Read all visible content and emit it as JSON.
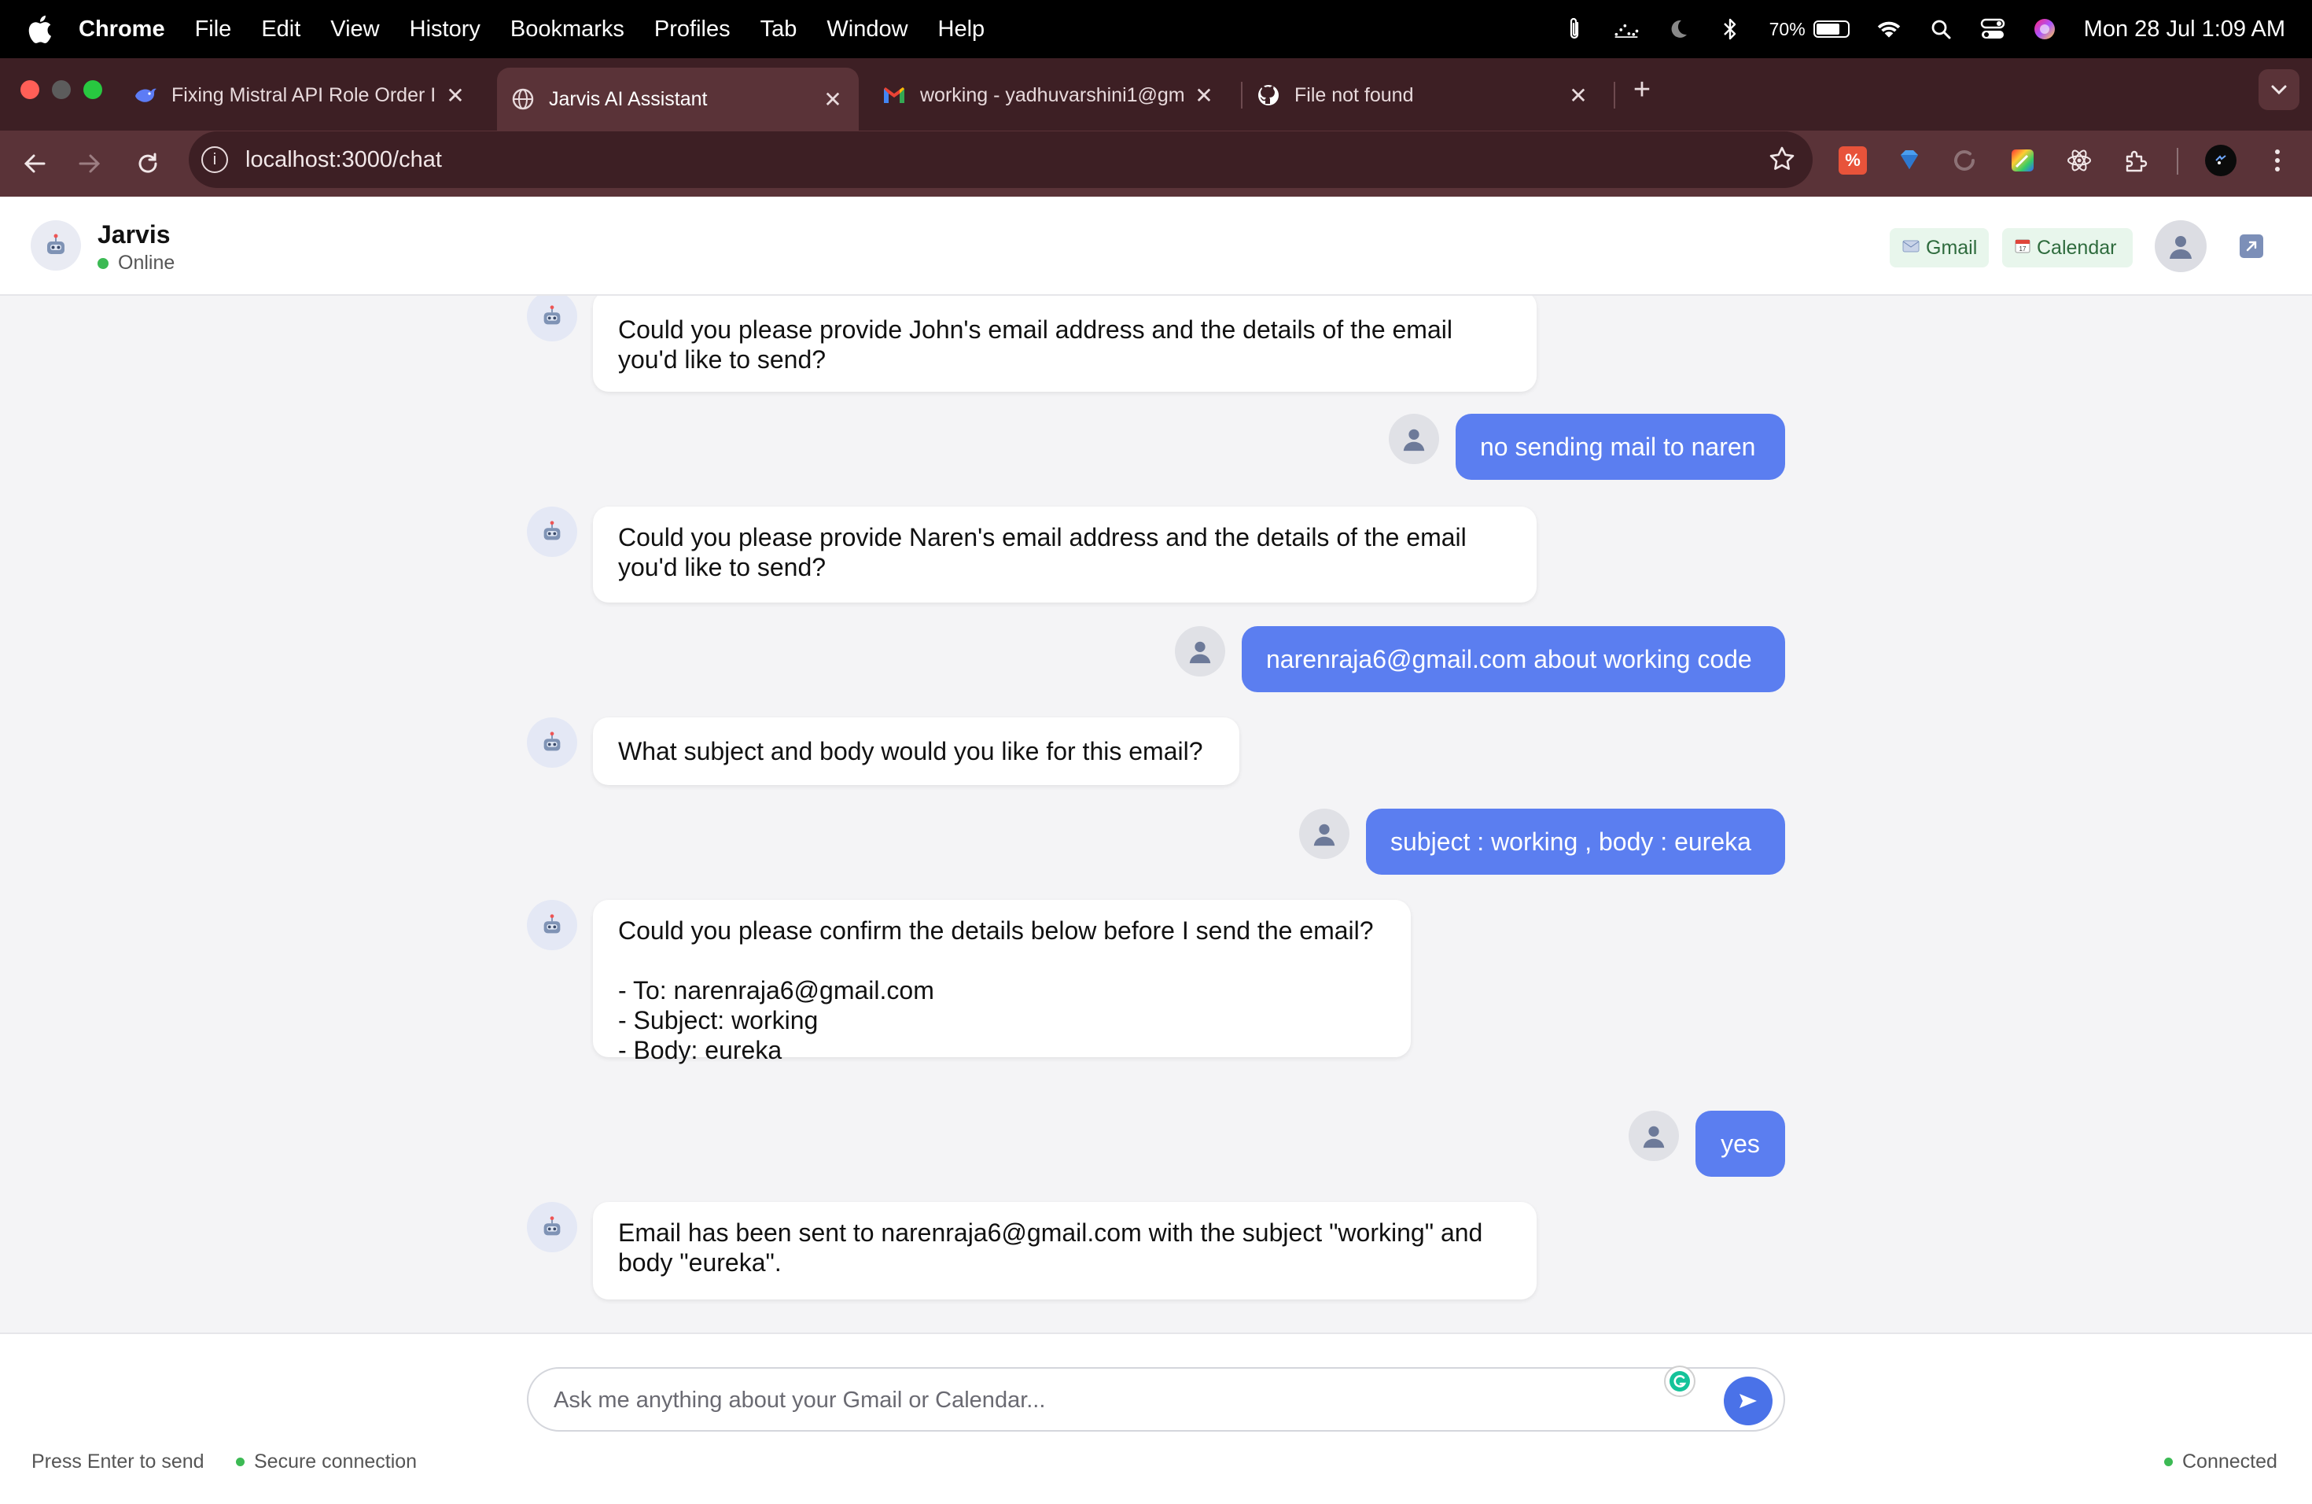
{
  "menubar": {
    "app": "Chrome",
    "menus": [
      "File",
      "Edit",
      "View",
      "History",
      "Bookmarks",
      "Profiles",
      "Tab",
      "Window",
      "Help"
    ],
    "battery": "70%",
    "datetime": "Mon 28 Jul  1:09 AM"
  },
  "tabs": [
    {
      "title": "Fixing Mistral API Role Order I",
      "icon": "deepseek-whale-icon",
      "active": false
    },
    {
      "title": "Jarvis AI Assistant",
      "icon": "globe-icon",
      "active": true
    },
    {
      "title": "working - yadhuvarshini1@gm",
      "icon": "gmail-icon",
      "active": false
    },
    {
      "title": "File not found",
      "icon": "github-icon",
      "active": false
    }
  ],
  "toolbar": {
    "url": "localhost:3000/chat"
  },
  "header": {
    "name": "Jarvis",
    "status": "Online",
    "gmail_chip": "Gmail",
    "calendar_chip": "Calendar"
  },
  "messages": [
    {
      "role": "assistant",
      "text": "Could you please provide John's email address and the details of the email\nyou'd like to send?"
    },
    {
      "role": "user",
      "text": "no sending mail to naren"
    },
    {
      "role": "assistant",
      "text": "Could you please provide Naren's email address and the details of the email\nyou'd like to send?"
    },
    {
      "role": "user",
      "text": "narenraja6@gmail.com about working code"
    },
    {
      "role": "assistant",
      "text": "What subject and body would you like for this email?"
    },
    {
      "role": "user",
      "text": "subject : working , body : eureka"
    },
    {
      "role": "assistant",
      "text": "Could you please confirm the details below before I send the email?\n\n- To: narenraja6@gmail.com\n- Subject: working\n- Body: eureka"
    },
    {
      "role": "user",
      "text": "yes"
    },
    {
      "role": "assistant",
      "text": "Email has been sent to narenraja6@gmail.com with the subject \"working\" and\nbody \"eureka\"."
    }
  ],
  "composer": {
    "placeholder": "Ask me anything about your Gmail or Calendar...",
    "hint": "Press Enter to send",
    "secure": "Secure connection",
    "connection": "Connected"
  },
  "colors": {
    "accent": "#5b7ef0",
    "tab_strip": "#3d1f24",
    "toolbar": "#5a3338",
    "online": "#3cba54"
  }
}
